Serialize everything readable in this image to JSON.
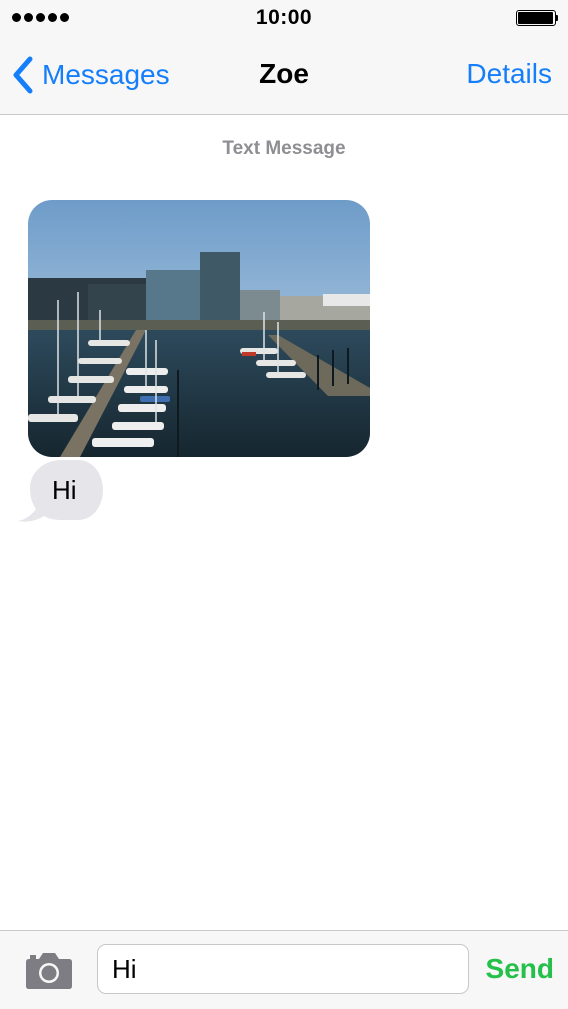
{
  "status_bar": {
    "time": "10:00",
    "signal_icon": "signal-dots-icon",
    "battery_icon": "battery-icon"
  },
  "nav": {
    "back_label": "Messages",
    "back_icon": "chevron-left-icon",
    "title": "Zoe",
    "details_label": "Details"
  },
  "conversation": {
    "meta_label": "Text Message",
    "messages": [
      {
        "kind": "image",
        "description_icon": "harbor-photo"
      },
      {
        "kind": "text",
        "text": "Hi"
      }
    ]
  },
  "composer": {
    "input_value": "Hi",
    "send_label": "Send",
    "camera_icon": "camera-icon"
  },
  "colors": {
    "accent": "#157efb",
    "send": "#25c04a",
    "bubble_gray": "#e5e5ea",
    "meta_text": "#8e8e93"
  }
}
